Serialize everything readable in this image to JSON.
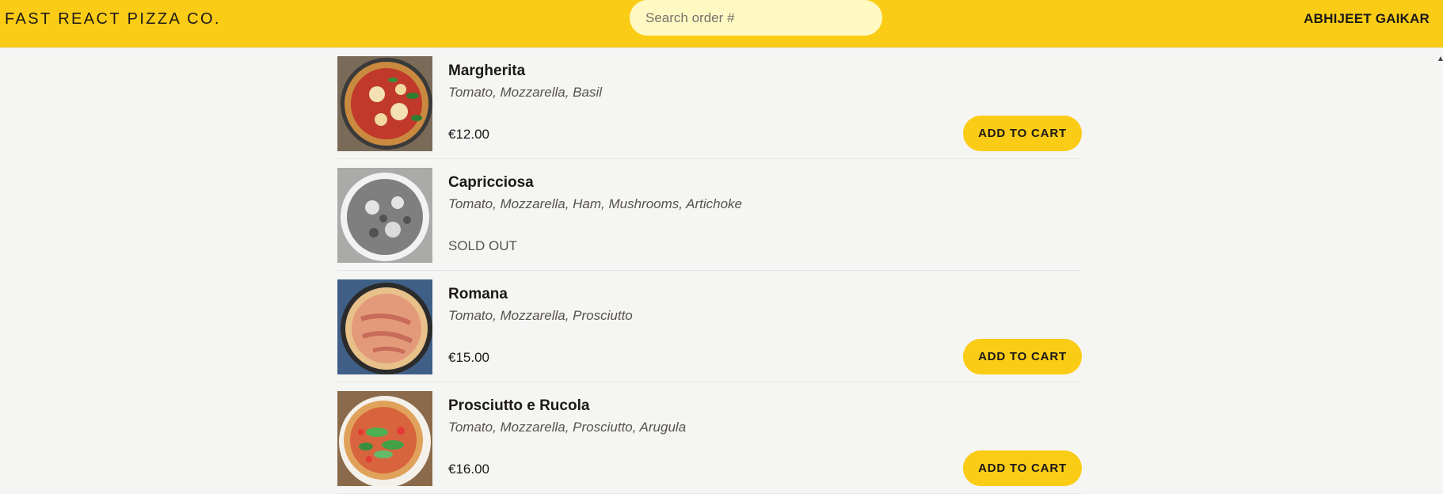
{
  "header": {
    "brand": "FAST REACT PIZZA CO.",
    "search_placeholder": "Search order #",
    "username": "ABHIJEET GAIKAR"
  },
  "menu": {
    "items": [
      {
        "name": "Margherita",
        "ingredients": "Tomato, Mozzarella, Basil",
        "price": "€12.00",
        "button": "ADD TO CART"
      },
      {
        "name": "Capricciosa",
        "ingredients": "Tomato, Mozzarella, Ham, Mushrooms, Artichoke",
        "status": "SOLD OUT"
      },
      {
        "name": "Romana",
        "ingredients": "Tomato, Mozzarella, Prosciutto",
        "price": "€15.00",
        "button": "ADD TO CART"
      },
      {
        "name": "Prosciutto e Rucola",
        "ingredients": "Tomato, Mozzarella, Prosciutto, Arugula",
        "price": "€16.00",
        "button": "ADD TO CART"
      }
    ]
  },
  "colors": {
    "accent": "#facc15",
    "search_bg": "#fef9c3",
    "background": "#f5f5f4",
    "text": "#1c1917",
    "muted": "#57534e"
  }
}
